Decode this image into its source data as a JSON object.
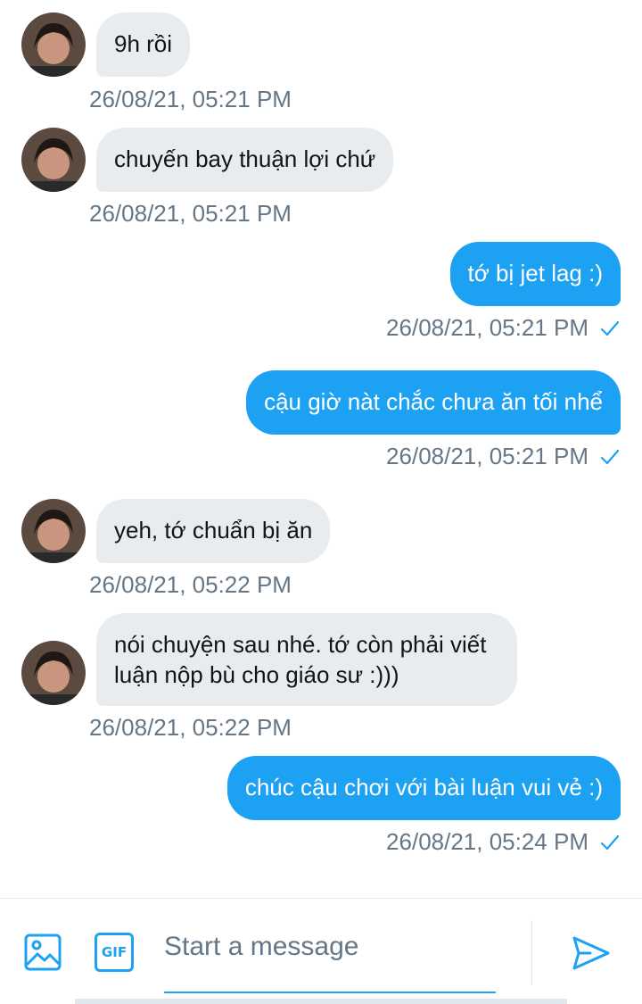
{
  "colors": {
    "accent": "#1da1f2",
    "incoming_bubble": "#e9ecef",
    "timestamp": "#657786"
  },
  "messages": [
    {
      "direction": "incoming",
      "text": "9h rồi",
      "time": "26/08/21, 05:21 PM"
    },
    {
      "direction": "incoming",
      "text": "chuyến bay thuận lợi chứ",
      "time": "26/08/21, 05:21 PM"
    },
    {
      "direction": "outgoing",
      "text": "tớ bị jet lag :)",
      "time": "26/08/21, 05:21 PM",
      "status_icon": "check-icon"
    },
    {
      "direction": "outgoing",
      "text": "cậu giờ nàt chắc chưa ăn tối nhể",
      "time": "26/08/21, 05:21 PM",
      "status_icon": "check-icon"
    },
    {
      "direction": "incoming",
      "text": "yeh, tớ chuẩn bị ăn",
      "time": "26/08/21, 05:22 PM"
    },
    {
      "direction": "incoming",
      "text": "nói chuyện sau nhé. tớ còn phải viết luận nộp bù cho giáo sư :)))",
      "time": "26/08/21, 05:22 PM"
    },
    {
      "direction": "outgoing",
      "text": "chúc cậu chơi với bài luận vui vẻ :)",
      "time": "26/08/21, 05:24 PM",
      "status_icon": "check-icon"
    }
  ],
  "composer": {
    "placeholder": "Start a message",
    "value": "",
    "gif_label": "GIF",
    "icons": [
      "image-icon",
      "gif-icon",
      "send-icon"
    ]
  }
}
